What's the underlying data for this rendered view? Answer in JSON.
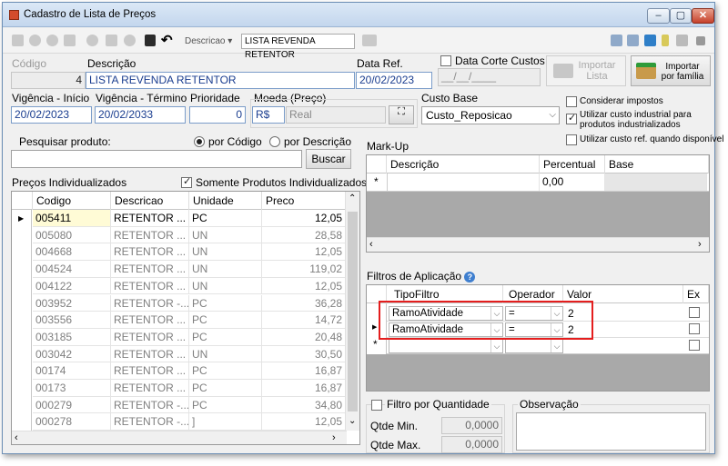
{
  "window": {
    "title": "Cadastro de Lista de Preços"
  },
  "toolbar": {
    "field_label": "Descricao",
    "search_value": "LISTA REVENDA RETENTOR"
  },
  "header": {
    "codigo_label": "Código",
    "codigo_value": "4",
    "descricao_label": "Descrição",
    "descricao_value": "LISTA REVENDA RETENTOR",
    "data_ref_label": "Data Ref.",
    "data_ref_value": "20/02/2023",
    "data_corte_label": "Data Corte Custos",
    "data_corte_value": "__/__/____",
    "importar_lista_label": "Importar Lista",
    "importar_familia_label": "Importar por família",
    "vig_ini_label": "Vigência - Início",
    "vig_ini_value": "20/02/2023",
    "vig_fim_label": "Vigência - Término",
    "vig_fim_value": "20/02/2033",
    "prioridade_label": "Prioridade",
    "prioridade_value": "0",
    "moeda_label": "Moeda (Preço)",
    "moeda_code": "R$",
    "moeda_name": "Real",
    "custo_base_label": "Custo Base",
    "custo_base_value": "Custo_Reposicao",
    "considerar_impostos": "Considerar impostos",
    "custo_industrial": "Utilizar custo industrial para produtos industrializados",
    "custo_ref": "Utilizar custo ref. quando disponível"
  },
  "search": {
    "label": "Pesquisar produto:",
    "opt_codigo": "por Código",
    "opt_descricao": "por Descrição",
    "button": "Buscar"
  },
  "precos": {
    "title": "Preços Individualizados",
    "somente": "Somente Produtos Individualizados",
    "columns": [
      "Codigo",
      "Descricao",
      "Unidade",
      "Preco"
    ],
    "rows": [
      {
        "codigo": "005411",
        "descricao": "RETENTOR ...",
        "unidade": "PC",
        "preco": "12,05"
      },
      {
        "codigo": "005080",
        "descricao": "RETENTOR ...",
        "unidade": "UN",
        "preco": "28,58"
      },
      {
        "codigo": "004668",
        "descricao": "RETENTOR ...",
        "unidade": "UN",
        "preco": "12,05"
      },
      {
        "codigo": "004524",
        "descricao": "RETENTOR ...",
        "unidade": "UN",
        "preco": "119,02"
      },
      {
        "codigo": "004122",
        "descricao": "RETENTOR ...",
        "unidade": "UN",
        "preco": "12,05"
      },
      {
        "codigo": "003952",
        "descricao": "RETENTOR -...",
        "unidade": "PC",
        "preco": "36,28"
      },
      {
        "codigo": "003556",
        "descricao": "RETENTOR ...",
        "unidade": "PC",
        "preco": "14,72"
      },
      {
        "codigo": "003185",
        "descricao": "RETENTOR ...",
        "unidade": "PC",
        "preco": "20,48"
      },
      {
        "codigo": "003042",
        "descricao": "RETENTOR ...",
        "unidade": "UN",
        "preco": "30,50"
      },
      {
        "codigo": "00174",
        "descricao": "RETENTOR ...",
        "unidade": "PC",
        "preco": "16,87"
      },
      {
        "codigo": "00173",
        "descricao": "RETENTOR ...",
        "unidade": "PC",
        "preco": "16,87"
      },
      {
        "codigo": "000279",
        "descricao": "RETENTOR -...",
        "unidade": "PC",
        "preco": "34,80"
      },
      {
        "codigo": "000278",
        "descricao": "RETENTOR -...",
        "unidade": "]",
        "preco": "12,05"
      }
    ]
  },
  "markup": {
    "title": "Mark-Up",
    "columns": [
      "Descrição",
      "Percentual",
      "Base"
    ],
    "new_row_percentual": "0,00"
  },
  "filtros": {
    "title": "Filtros de Aplicação",
    "columns": [
      "TipoFiltro",
      "Operador",
      "Valor",
      "Ex"
    ],
    "rows": [
      {
        "tipo": "RamoAtividade",
        "operador": "=",
        "valor": "2"
      },
      {
        "tipo": "RamoAtividade",
        "operador": "=",
        "valor": "2"
      }
    ]
  },
  "quantidade": {
    "title": "Filtro por Quantidade",
    "min_label": "Qtde Min.",
    "min_value": "0,0000",
    "max_label": "Qtde Max.",
    "max_value": "0,0000"
  },
  "observacao": {
    "title": "Observação"
  },
  "colors": {
    "highlight": "#e41e1e",
    "input_border": "#7a9cc9"
  }
}
